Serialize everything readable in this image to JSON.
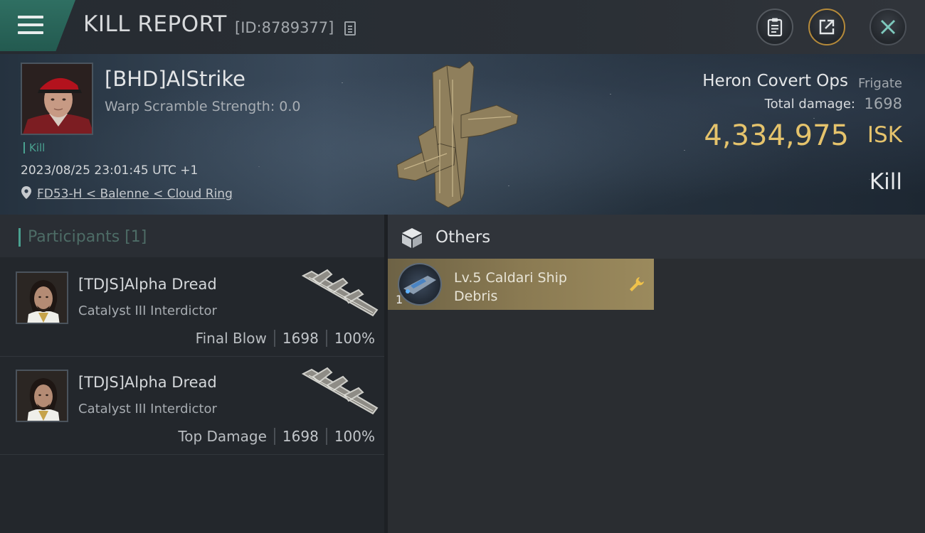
{
  "header": {
    "title": "KILL REPORT",
    "report_id": "[ID:8789377]",
    "menu_icon": "hamburger-menu-icon",
    "actions": [
      {
        "name": "clipboard",
        "icon": "clipboard-icon"
      },
      {
        "name": "share",
        "icon": "share-icon"
      },
      {
        "name": "close",
        "icon": "close-icon"
      }
    ]
  },
  "victim": {
    "name": "[BHD]AlStrike",
    "warp_scramble": "Warp Scramble Strength: 0.0",
    "kill_tag": "Kill",
    "datetime": "2023/08/25 23:01:45 UTC +1",
    "location": "FD53-H < Balenne < Cloud Ring",
    "ship_name": "Heron Covert Ops",
    "ship_class": "Frigate",
    "total_damage_label": "Total damage:",
    "total_damage": "1698",
    "isk_value": "4,334,975",
    "isk_unit": "ISK",
    "result": "Kill"
  },
  "participants": {
    "title": "Participants [1]",
    "list": [
      {
        "name": "[TDJS]Alpha Dread",
        "ship": "Catalyst III Interdictor",
        "role": "Final Blow",
        "damage": "1698",
        "percent": "100%"
      },
      {
        "name": "[TDJS]Alpha Dread",
        "ship": "Catalyst III Interdictor",
        "role": "Top Damage",
        "damage": "1698",
        "percent": "100%"
      }
    ]
  },
  "others": {
    "title": "Others",
    "items": [
      {
        "quantity": "1",
        "name": "Lv.5 Caldari Ship Debris",
        "icon": "wrench-icon"
      }
    ]
  },
  "colors": {
    "accent_teal": "#4aa190",
    "isk_gold": "#e5c36c",
    "item_card": "#8a7a52"
  }
}
